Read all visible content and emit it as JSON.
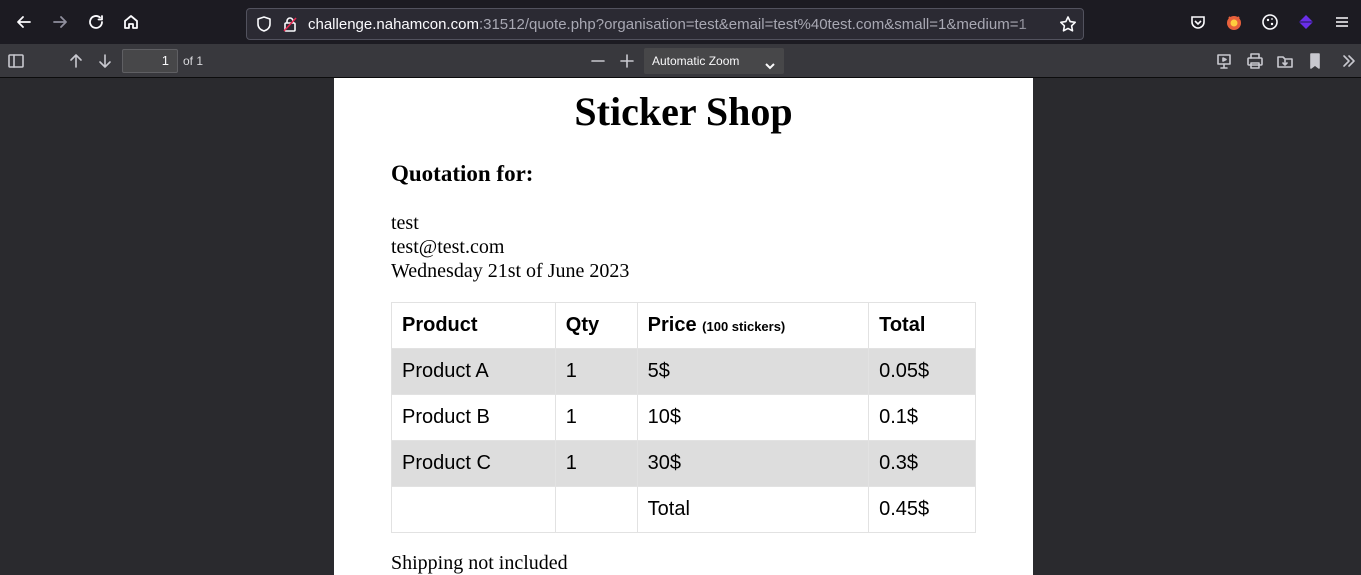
{
  "browser": {
    "url_host": "challenge.nahamcon.com",
    "url_rest": ":31512/quote.php?organisation=test&email=test%40test.com&small=1&medium=1"
  },
  "pdf_toolbar": {
    "page_number": "1",
    "page_of": "of 1",
    "zoom": "Automatic Zoom"
  },
  "document": {
    "title": "Sticker Shop",
    "quotation_heading": "Quotation for:",
    "organisation": "test",
    "email": "test@test.com",
    "date": "Wednesday 21st of June 2023",
    "table": {
      "headers": [
        "Product",
        "Qty",
        "Price",
        "(100 stickers)",
        "Total"
      ],
      "rows": [
        [
          "Product A",
          "1",
          "5$",
          "0.05$"
        ],
        [
          "Product B",
          "1",
          "10$",
          "0.1$"
        ],
        [
          "Product C",
          "1",
          "30$",
          "0.3$"
        ],
        [
          "",
          "",
          "Total",
          "0.45$"
        ]
      ]
    },
    "footer_note": "Shipping not included"
  },
  "colors": {
    "chrome_bg": "#1c1b22",
    "toolbar_bg": "#38383d",
    "viewer_bg": "#2a2a2e",
    "row_shade": "#dddddd"
  }
}
